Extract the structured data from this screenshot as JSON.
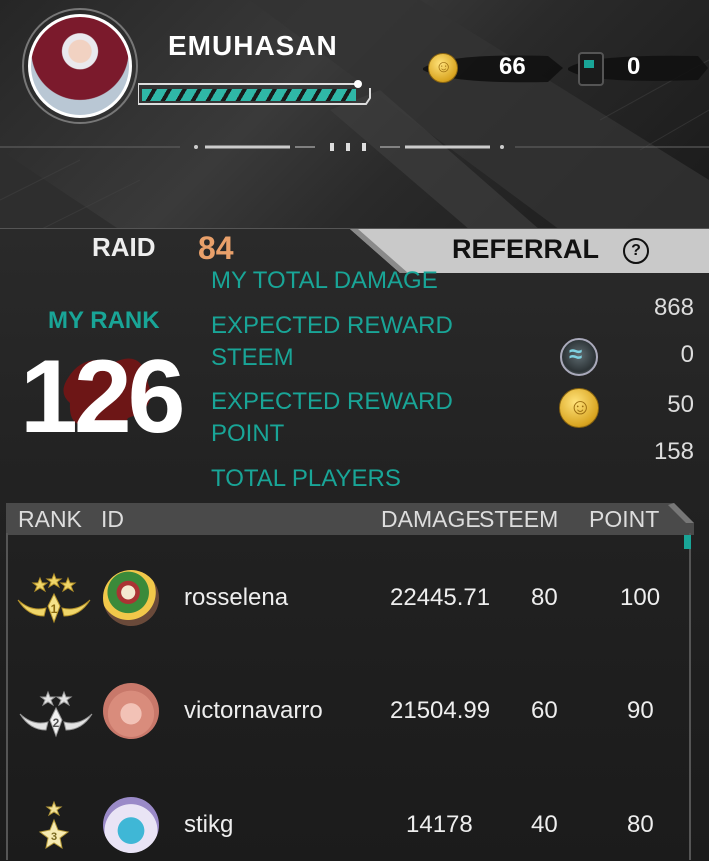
{
  "profile": {
    "username": "EMUHASAN",
    "xp_fraction": 0.93
  },
  "currencies": [
    {
      "icon": "coin-icon",
      "value": "66"
    },
    {
      "icon": "ticket-icon",
      "value": "0"
    }
  ],
  "tabs": {
    "raid_label": "RAID",
    "raid_number": "84",
    "referral_label": "REFERRAL",
    "help_glyph": "?"
  },
  "my_rank": {
    "label": "MY RANK",
    "value": "126"
  },
  "stats": {
    "total_damage_label": "MY TOTAL DAMAGE",
    "total_damage_value": "868",
    "reward_steem_label_1": "EXPECTED REWARD",
    "reward_steem_label_2": "STEEM",
    "reward_steem_value": "0",
    "reward_point_label_1": "EXPECTED REWARD",
    "reward_point_label_2": "POINT",
    "reward_point_value": "50",
    "total_players_label": "TOTAL PLAYERS",
    "total_players_value": "158"
  },
  "table": {
    "headers": {
      "rank": "RANK",
      "id": "ID",
      "damage": "DAMAGE",
      "steem": "STEEM",
      "point": "POINT"
    },
    "rows": [
      {
        "rank": "1",
        "name": "rosselena",
        "damage": "22445.71",
        "steem": "80",
        "point": "100"
      },
      {
        "rank": "2",
        "name": "victornavarro",
        "damage": "21504.99",
        "steem": "60",
        "point": "90"
      },
      {
        "rank": "3",
        "name": "stikg",
        "damage": "14178",
        "steem": "40",
        "point": "80"
      }
    ]
  },
  "colors": {
    "accent_teal": "#19a597",
    "raid_orange": "#e9a06a",
    "gold": "#e8c84a"
  }
}
